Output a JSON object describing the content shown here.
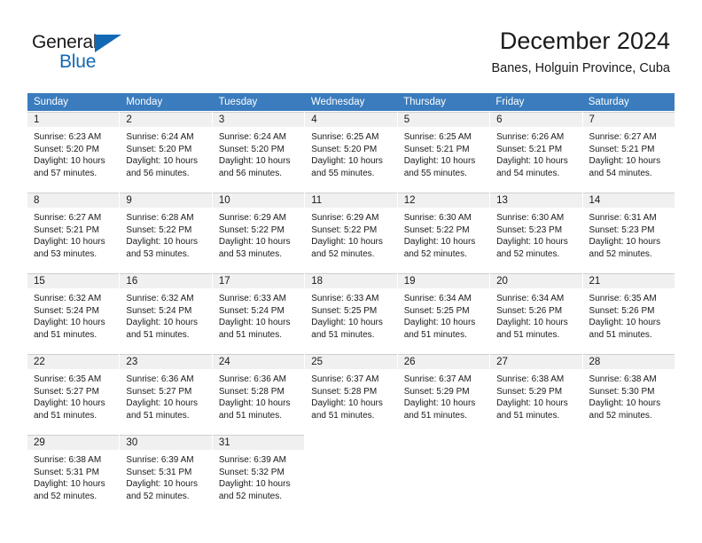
{
  "brand": {
    "name_top": "General",
    "name_bottom": "Blue",
    "accent_color": "#1268b3"
  },
  "header": {
    "title": "December 2024",
    "subtitle": "Banes, Holguin Province, Cuba"
  },
  "calendar": {
    "header_bg": "#3a7cbe",
    "daynum_bg": "#f0f0f0",
    "weekday_headers": [
      "Sunday",
      "Monday",
      "Tuesday",
      "Wednesday",
      "Thursday",
      "Friday",
      "Saturday"
    ],
    "weeks": [
      [
        {
          "day": "1",
          "sunrise": "Sunrise: 6:23 AM",
          "sunset": "Sunset: 5:20 PM",
          "daylight1": "Daylight: 10 hours",
          "daylight2": "and 57 minutes."
        },
        {
          "day": "2",
          "sunrise": "Sunrise: 6:24 AM",
          "sunset": "Sunset: 5:20 PM",
          "daylight1": "Daylight: 10 hours",
          "daylight2": "and 56 minutes."
        },
        {
          "day": "3",
          "sunrise": "Sunrise: 6:24 AM",
          "sunset": "Sunset: 5:20 PM",
          "daylight1": "Daylight: 10 hours",
          "daylight2": "and 56 minutes."
        },
        {
          "day": "4",
          "sunrise": "Sunrise: 6:25 AM",
          "sunset": "Sunset: 5:20 PM",
          "daylight1": "Daylight: 10 hours",
          "daylight2": "and 55 minutes."
        },
        {
          "day": "5",
          "sunrise": "Sunrise: 6:25 AM",
          "sunset": "Sunset: 5:21 PM",
          "daylight1": "Daylight: 10 hours",
          "daylight2": "and 55 minutes."
        },
        {
          "day": "6",
          "sunrise": "Sunrise: 6:26 AM",
          "sunset": "Sunset: 5:21 PM",
          "daylight1": "Daylight: 10 hours",
          "daylight2": "and 54 minutes."
        },
        {
          "day": "7",
          "sunrise": "Sunrise: 6:27 AM",
          "sunset": "Sunset: 5:21 PM",
          "daylight1": "Daylight: 10 hours",
          "daylight2": "and 54 minutes."
        }
      ],
      [
        {
          "day": "8",
          "sunrise": "Sunrise: 6:27 AM",
          "sunset": "Sunset: 5:21 PM",
          "daylight1": "Daylight: 10 hours",
          "daylight2": "and 53 minutes."
        },
        {
          "day": "9",
          "sunrise": "Sunrise: 6:28 AM",
          "sunset": "Sunset: 5:22 PM",
          "daylight1": "Daylight: 10 hours",
          "daylight2": "and 53 minutes."
        },
        {
          "day": "10",
          "sunrise": "Sunrise: 6:29 AM",
          "sunset": "Sunset: 5:22 PM",
          "daylight1": "Daylight: 10 hours",
          "daylight2": "and 53 minutes."
        },
        {
          "day": "11",
          "sunrise": "Sunrise: 6:29 AM",
          "sunset": "Sunset: 5:22 PM",
          "daylight1": "Daylight: 10 hours",
          "daylight2": "and 52 minutes."
        },
        {
          "day": "12",
          "sunrise": "Sunrise: 6:30 AM",
          "sunset": "Sunset: 5:22 PM",
          "daylight1": "Daylight: 10 hours",
          "daylight2": "and 52 minutes."
        },
        {
          "day": "13",
          "sunrise": "Sunrise: 6:30 AM",
          "sunset": "Sunset: 5:23 PM",
          "daylight1": "Daylight: 10 hours",
          "daylight2": "and 52 minutes."
        },
        {
          "day": "14",
          "sunrise": "Sunrise: 6:31 AM",
          "sunset": "Sunset: 5:23 PM",
          "daylight1": "Daylight: 10 hours",
          "daylight2": "and 52 minutes."
        }
      ],
      [
        {
          "day": "15",
          "sunrise": "Sunrise: 6:32 AM",
          "sunset": "Sunset: 5:24 PM",
          "daylight1": "Daylight: 10 hours",
          "daylight2": "and 51 minutes."
        },
        {
          "day": "16",
          "sunrise": "Sunrise: 6:32 AM",
          "sunset": "Sunset: 5:24 PM",
          "daylight1": "Daylight: 10 hours",
          "daylight2": "and 51 minutes."
        },
        {
          "day": "17",
          "sunrise": "Sunrise: 6:33 AM",
          "sunset": "Sunset: 5:24 PM",
          "daylight1": "Daylight: 10 hours",
          "daylight2": "and 51 minutes."
        },
        {
          "day": "18",
          "sunrise": "Sunrise: 6:33 AM",
          "sunset": "Sunset: 5:25 PM",
          "daylight1": "Daylight: 10 hours",
          "daylight2": "and 51 minutes."
        },
        {
          "day": "19",
          "sunrise": "Sunrise: 6:34 AM",
          "sunset": "Sunset: 5:25 PM",
          "daylight1": "Daylight: 10 hours",
          "daylight2": "and 51 minutes."
        },
        {
          "day": "20",
          "sunrise": "Sunrise: 6:34 AM",
          "sunset": "Sunset: 5:26 PM",
          "daylight1": "Daylight: 10 hours",
          "daylight2": "and 51 minutes."
        },
        {
          "day": "21",
          "sunrise": "Sunrise: 6:35 AM",
          "sunset": "Sunset: 5:26 PM",
          "daylight1": "Daylight: 10 hours",
          "daylight2": "and 51 minutes."
        }
      ],
      [
        {
          "day": "22",
          "sunrise": "Sunrise: 6:35 AM",
          "sunset": "Sunset: 5:27 PM",
          "daylight1": "Daylight: 10 hours",
          "daylight2": "and 51 minutes."
        },
        {
          "day": "23",
          "sunrise": "Sunrise: 6:36 AM",
          "sunset": "Sunset: 5:27 PM",
          "daylight1": "Daylight: 10 hours",
          "daylight2": "and 51 minutes."
        },
        {
          "day": "24",
          "sunrise": "Sunrise: 6:36 AM",
          "sunset": "Sunset: 5:28 PM",
          "daylight1": "Daylight: 10 hours",
          "daylight2": "and 51 minutes."
        },
        {
          "day": "25",
          "sunrise": "Sunrise: 6:37 AM",
          "sunset": "Sunset: 5:28 PM",
          "daylight1": "Daylight: 10 hours",
          "daylight2": "and 51 minutes."
        },
        {
          "day": "26",
          "sunrise": "Sunrise: 6:37 AM",
          "sunset": "Sunset: 5:29 PM",
          "daylight1": "Daylight: 10 hours",
          "daylight2": "and 51 minutes."
        },
        {
          "day": "27",
          "sunrise": "Sunrise: 6:38 AM",
          "sunset": "Sunset: 5:29 PM",
          "daylight1": "Daylight: 10 hours",
          "daylight2": "and 51 minutes."
        },
        {
          "day": "28",
          "sunrise": "Sunrise: 6:38 AM",
          "sunset": "Sunset: 5:30 PM",
          "daylight1": "Daylight: 10 hours",
          "daylight2": "and 52 minutes."
        }
      ],
      [
        {
          "day": "29",
          "sunrise": "Sunrise: 6:38 AM",
          "sunset": "Sunset: 5:31 PM",
          "daylight1": "Daylight: 10 hours",
          "daylight2": "and 52 minutes."
        },
        {
          "day": "30",
          "sunrise": "Sunrise: 6:39 AM",
          "sunset": "Sunset: 5:31 PM",
          "daylight1": "Daylight: 10 hours",
          "daylight2": "and 52 minutes."
        },
        {
          "day": "31",
          "sunrise": "Sunrise: 6:39 AM",
          "sunset": "Sunset: 5:32 PM",
          "daylight1": "Daylight: 10 hours",
          "daylight2": "and 52 minutes."
        },
        {
          "day": "",
          "sunrise": "",
          "sunset": "",
          "daylight1": "",
          "daylight2": ""
        },
        {
          "day": "",
          "sunrise": "",
          "sunset": "",
          "daylight1": "",
          "daylight2": ""
        },
        {
          "day": "",
          "sunrise": "",
          "sunset": "",
          "daylight1": "",
          "daylight2": ""
        },
        {
          "day": "",
          "sunrise": "",
          "sunset": "",
          "daylight1": "",
          "daylight2": ""
        }
      ]
    ]
  }
}
